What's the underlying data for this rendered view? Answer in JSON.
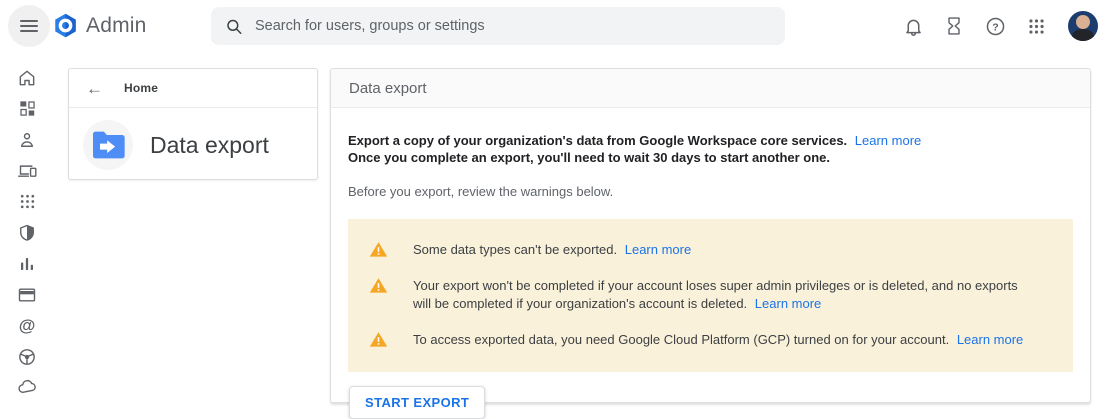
{
  "topbar": {
    "app_title": "Admin",
    "search_placeholder": "Search for users, groups or settings",
    "icons": [
      "menu-icon",
      "admin-logo",
      "search-icon",
      "notifications-bell-icon",
      "hourglass-tasks-icon",
      "help-icon",
      "apps-grid-icon",
      "avatar"
    ]
  },
  "sidebar": {
    "items": [
      {
        "icon": "home-icon"
      },
      {
        "icon": "dashboard-icon"
      },
      {
        "icon": "directory-person-icon"
      },
      {
        "icon": "devices-icon"
      },
      {
        "icon": "apps-icon"
      },
      {
        "icon": "security-shield-icon"
      },
      {
        "icon": "reporting-chart-icon"
      },
      {
        "icon": "billing-card-icon"
      },
      {
        "icon": "account-at-icon"
      },
      {
        "icon": "rules-steering-icon"
      },
      {
        "icon": "storage-cloud-icon"
      }
    ]
  },
  "breadcrumb_panel": {
    "back_label": "Home",
    "title": "Data export",
    "icon": "data-export-folder-icon"
  },
  "main": {
    "header_title": "Data export",
    "intro_line1": "Export a copy of your organization's data from Google Workspace core services.",
    "intro_line1_link": "Learn more",
    "intro_line2": "Once you complete an export, you'll need to wait 30 days to start another one.",
    "review_text": "Before you export, review the warnings below.",
    "warnings": [
      {
        "icon": "warning-triangle-icon",
        "text": "Some data types can't be exported.",
        "link": "Learn more"
      },
      {
        "icon": "warning-triangle-icon",
        "text": "Your export won't be completed if your account loses super admin privileges or is deleted, and no exports will be completed if your organization's account is deleted.",
        "link": "Learn more"
      },
      {
        "icon": "warning-triangle-icon",
        "text": "To access exported data, you need Google Cloud Platform (GCP) turned on for your account.",
        "link": "Learn more"
      }
    ],
    "start_button_label": "START EXPORT"
  },
  "colors": {
    "accent_blue": "#1a73e8",
    "logo_blue": "#2b7de9",
    "warning_bg": "#faf1da",
    "warning_icon": "#f5a623",
    "text_dark": "#202124",
    "text_gray": "#5f6368"
  }
}
